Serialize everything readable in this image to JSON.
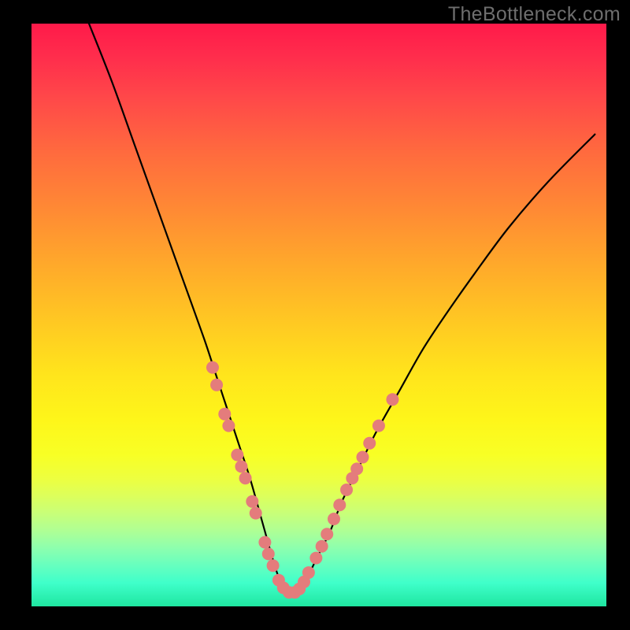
{
  "watermark": "TheBottleneck.com",
  "colors": {
    "background_frame": "#000000",
    "curve_stroke": "#000000",
    "marker_fill": "#e47c7c",
    "marker_stroke": "#c96262",
    "watermark": "#6e6e6e"
  },
  "chart_data": {
    "type": "line",
    "title": "",
    "xlabel": "",
    "ylabel": "",
    "xlim": [
      0,
      100
    ],
    "ylim": [
      0,
      100
    ],
    "grid": false,
    "legend": false,
    "notes": "Bottleneck-style V-curve over vertical rainbow gradient; x is a normalized configuration axis, y is a normalized bottleneck/severity percentage. Curve minimum ≈ x 43–47 at y ≈ 2.",
    "series": [
      {
        "name": "bottleneck-curve",
        "x": [
          10,
          14,
          18,
          22,
          26,
          30,
          32,
          34,
          36,
          38,
          40,
          42,
          43,
          44,
          45,
          46,
          47,
          48,
          50,
          52,
          54,
          57,
          60,
          64,
          68,
          72,
          77,
          83,
          90,
          98
        ],
        "y": [
          100,
          90,
          79,
          68,
          57,
          46,
          40,
          34,
          28,
          22,
          15,
          8,
          5,
          3,
          2,
          2,
          3,
          5,
          9,
          13,
          18,
          24,
          30,
          37,
          44,
          50,
          57,
          65,
          73,
          81
        ]
      }
    ],
    "markers": {
      "name": "highlight-points",
      "comment": "Pink highlight dots clustered along both arms near the trough",
      "points": [
        {
          "x": 31.5,
          "y": 41
        },
        {
          "x": 32.2,
          "y": 38
        },
        {
          "x": 33.6,
          "y": 33
        },
        {
          "x": 34.3,
          "y": 31
        },
        {
          "x": 35.8,
          "y": 26
        },
        {
          "x": 36.5,
          "y": 24
        },
        {
          "x": 37.2,
          "y": 22
        },
        {
          "x": 38.4,
          "y": 18
        },
        {
          "x": 39.0,
          "y": 16
        },
        {
          "x": 40.6,
          "y": 11
        },
        {
          "x": 41.2,
          "y": 9
        },
        {
          "x": 42.0,
          "y": 7
        },
        {
          "x": 43.0,
          "y": 4.5
        },
        {
          "x": 43.8,
          "y": 3.2
        },
        {
          "x": 44.8,
          "y": 2.4
        },
        {
          "x": 45.8,
          "y": 2.4
        },
        {
          "x": 46.6,
          "y": 3.0
        },
        {
          "x": 47.4,
          "y": 4.2
        },
        {
          "x": 48.2,
          "y": 5.8
        },
        {
          "x": 49.5,
          "y": 8.3
        },
        {
          "x": 50.5,
          "y": 10.3
        },
        {
          "x": 51.4,
          "y": 12.4
        },
        {
          "x": 52.6,
          "y": 15.0
        },
        {
          "x": 53.6,
          "y": 17.4
        },
        {
          "x": 54.8,
          "y": 20.0
        },
        {
          "x": 55.8,
          "y": 22.0
        },
        {
          "x": 56.6,
          "y": 23.6
        },
        {
          "x": 57.6,
          "y": 25.6
        },
        {
          "x": 58.8,
          "y": 28.0
        },
        {
          "x": 60.4,
          "y": 31.0
        },
        {
          "x": 62.8,
          "y": 35.5
        }
      ]
    }
  }
}
